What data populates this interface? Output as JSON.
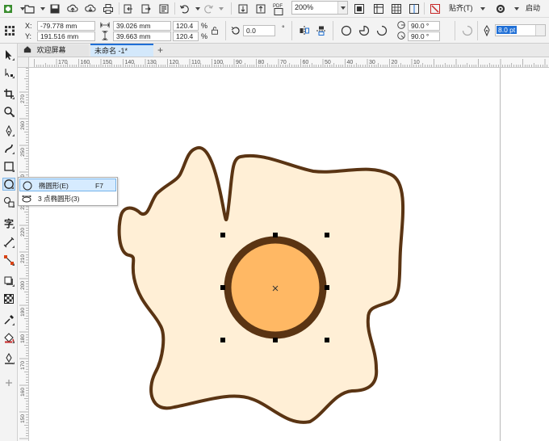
{
  "toolbar": {
    "zoom_value": "200%",
    "pdf_label": "PDF",
    "align_label": "贴齐(T)",
    "launch_label": "启动"
  },
  "properties": {
    "x_label": "X:",
    "x_value": "-79.778 mm",
    "y_label": "Y:",
    "y_value": "191.516 mm",
    "width_value": "39.026 mm",
    "height_value": "39.663 mm",
    "scale_w": "120.4",
    "scale_h": "120.4",
    "percent": "%",
    "rotation_value": "0.0",
    "degree_symbol": "°",
    "start_angle": "90.0 °",
    "end_angle": "90.0 °",
    "outline_width": "8.0 pt"
  },
  "tabs": [
    {
      "label": "欢迎屏幕"
    },
    {
      "label": "未命名 -1*"
    }
  ],
  "flyout": {
    "items": [
      {
        "label": "椭圆形(E)",
        "shortcut": "F7"
      },
      {
        "label": "3 点椭圆形(3)",
        "shortcut": ""
      }
    ]
  },
  "ruler": {
    "h_ticks": [
      "170",
      "160",
      "150",
      "140",
      "130",
      "120",
      "110",
      "100",
      "90",
      "80",
      "70",
      "60",
      "50",
      "40",
      "30",
      "20",
      "10"
    ],
    "v_ticks": [
      "270",
      "260",
      "250",
      "240",
      "230",
      "220",
      "210",
      "200",
      "190",
      "180",
      "170",
      "160",
      "150"
    ]
  },
  "colors": {
    "egg_white_fill": "#ffefd6",
    "egg_outline": "#5a3413",
    "yolk_fill": "#ffb864",
    "yolk_outline": "#5a3413",
    "selection_tool_bg": "#cfe6fb",
    "highlight_text": "#1f6fd6"
  }
}
